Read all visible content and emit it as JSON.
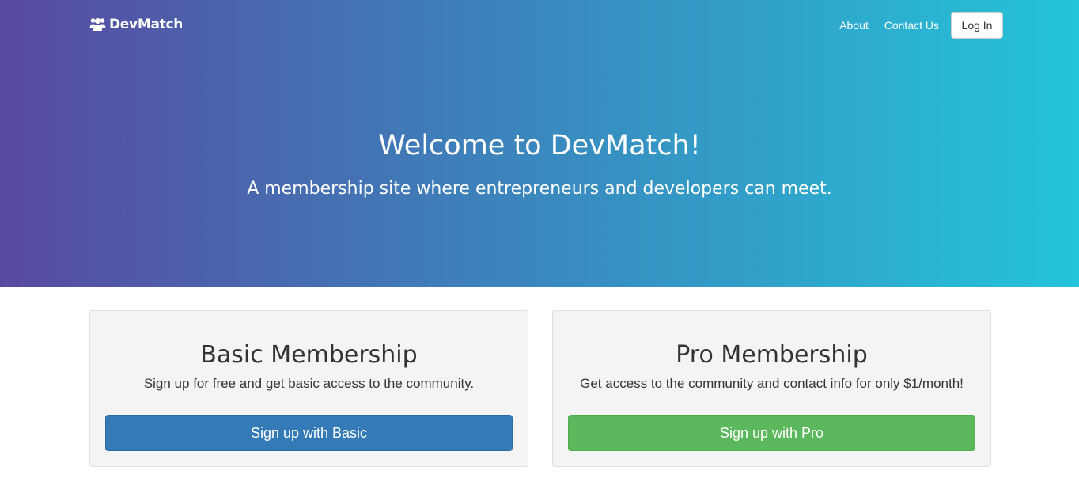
{
  "nav": {
    "brand": "DevMatch",
    "brand_icon": "users-icon",
    "links": [
      "About",
      "Contact Us"
    ],
    "login_label": "Log In"
  },
  "hero": {
    "title": "Welcome to DevMatch!",
    "subtitle": "A membership site where entrepreneurs and developers can meet."
  },
  "plans": [
    {
      "title": "Basic Membership",
      "description": "Sign up for free and get basic access to the community.",
      "button_label": "Sign up with Basic",
      "button_color": "#337ab7"
    },
    {
      "title": "Pro Membership",
      "description": "Get access to the community and contact info for only $1/month!",
      "button_label": "Sign up with Pro",
      "button_color": "#5cb85c"
    }
  ],
  "colors": {
    "gradient_start": "#58499f",
    "gradient_end": "#24c4da",
    "card_background": "#f4f4f4"
  }
}
